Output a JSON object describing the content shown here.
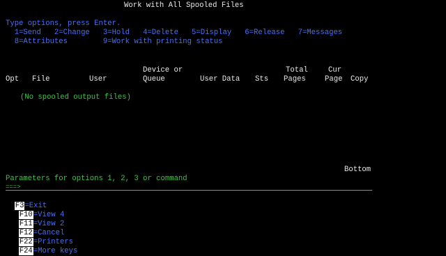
{
  "screen": {
    "title": "Work with All Spooled Files",
    "instructions": "Type options, press Enter.",
    "options_row1": "  1=Send   2=Change   3=Hold   4=Delete   5=Display   6=Release   7=Messages",
    "options_row2": "  8=Attributes        9=Work with printing status"
  },
  "columns": {
    "device_top": "Device or",
    "total_top": "Total",
    "cur_top": "Cur",
    "opt": "Opt",
    "file": "File",
    "user": "User",
    "queue": "Queue",
    "user_data": "User Data",
    "sts": "Sts",
    "pages": "Pages",
    "page": "Page",
    "copy": "Copy"
  },
  "list": {
    "empty_message": "(No spooled output files)",
    "position_indicator": "Bottom"
  },
  "command": {
    "label": "Parameters for options 1, 2, 3 or command",
    "prompt": "===>",
    "value": ""
  },
  "function_keys": [
    {
      "key": "F3",
      "label": "=Exit"
    },
    {
      "key": "F10",
      "label": "=View 4"
    },
    {
      "key": "F11",
      "label": "=View 2"
    },
    {
      "key": "F12",
      "label": "=Cancel"
    },
    {
      "key": "F22",
      "label": "=Printers"
    },
    {
      "key": "F24",
      "label": "=More keys"
    }
  ],
  "colors": {
    "background": "#000000",
    "heading": "#e9e9e9",
    "info": "#4a6ff2",
    "field": "#3fc04a"
  }
}
